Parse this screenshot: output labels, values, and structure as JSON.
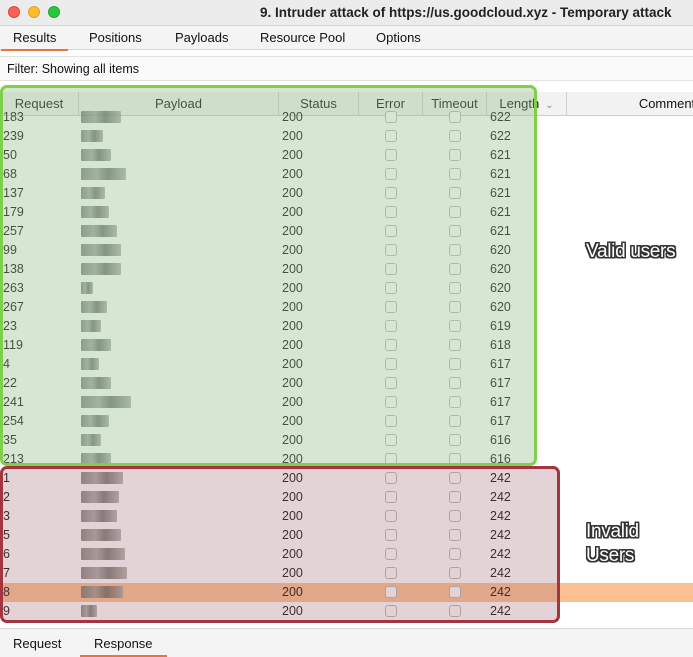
{
  "window": {
    "title": "9. Intruder attack of https://us.goodcloud.xyz - Temporary attack"
  },
  "tabs": [
    "Results",
    "Positions",
    "Payloads",
    "Resource Pool",
    "Options"
  ],
  "active_tab": "Results",
  "filter": {
    "label": "Filter: Showing all items"
  },
  "columns": [
    "Request",
    "Payload",
    "Status",
    "Error",
    "Timeout",
    "Length",
    "Comment"
  ],
  "rows": [
    {
      "request": "183",
      "status": "200",
      "length": "622"
    },
    {
      "request": "239",
      "status": "200",
      "length": "622"
    },
    {
      "request": "50",
      "status": "200",
      "length": "621"
    },
    {
      "request": "68",
      "status": "200",
      "length": "621"
    },
    {
      "request": "137",
      "status": "200",
      "length": "621"
    },
    {
      "request": "179",
      "status": "200",
      "length": "621"
    },
    {
      "request": "257",
      "status": "200",
      "length": "621"
    },
    {
      "request": "99",
      "status": "200",
      "length": "620"
    },
    {
      "request": "138",
      "status": "200",
      "length": "620"
    },
    {
      "request": "263",
      "status": "200",
      "length": "620"
    },
    {
      "request": "267",
      "status": "200",
      "length": "620"
    },
    {
      "request": "23",
      "status": "200",
      "length": "619"
    },
    {
      "request": "119",
      "status": "200",
      "length": "618"
    },
    {
      "request": "4",
      "status": "200",
      "length": "617"
    },
    {
      "request": "22",
      "status": "200",
      "length": "617"
    },
    {
      "request": "241",
      "status": "200",
      "length": "617"
    },
    {
      "request": "254",
      "status": "200",
      "length": "617"
    },
    {
      "request": "35",
      "status": "200",
      "length": "616"
    },
    {
      "request": "213",
      "status": "200",
      "length": "616"
    },
    {
      "request": "1",
      "status": "200",
      "length": "242"
    },
    {
      "request": "2",
      "status": "200",
      "length": "242"
    },
    {
      "request": "3",
      "status": "200",
      "length": "242"
    },
    {
      "request": "5",
      "status": "200",
      "length": "242"
    },
    {
      "request": "6",
      "status": "200",
      "length": "242"
    },
    {
      "request": "7",
      "status": "200",
      "length": "242"
    },
    {
      "request": "8",
      "status": "200",
      "length": "242",
      "selected": true
    },
    {
      "request": "9",
      "status": "200",
      "length": "242"
    }
  ],
  "annotations": {
    "valid": "Valid users",
    "invalid_line1": "Invalid",
    "invalid_line2": "Users"
  },
  "bottom_tabs": [
    "Request",
    "Response"
  ],
  "active_bottom_tab": "Response",
  "colors": {
    "accent": "#e8753a",
    "selected_row": "#fdc091",
    "valid_box": "#7fcf4a",
    "invalid_box": "#a4343f"
  }
}
